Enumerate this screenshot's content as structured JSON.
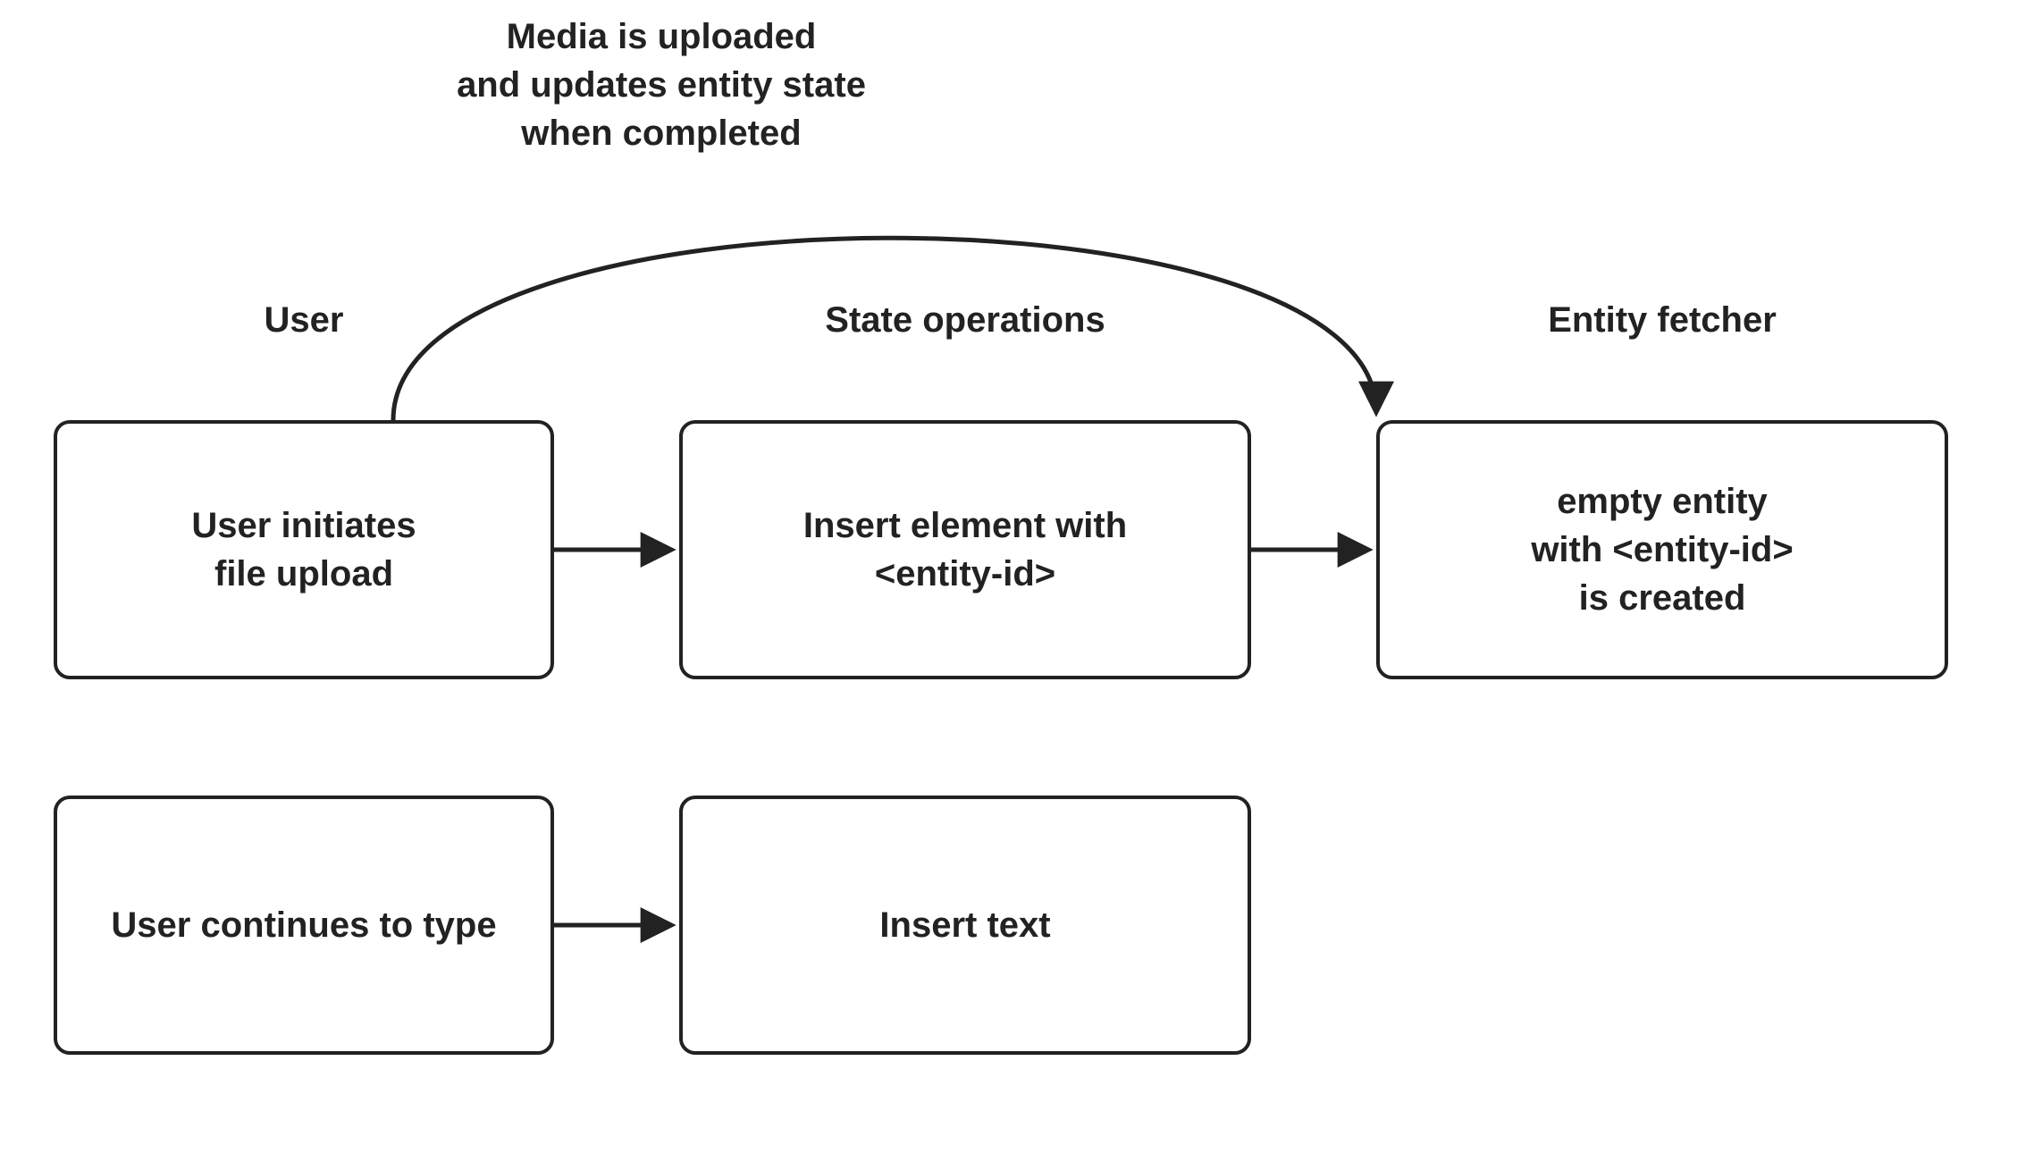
{
  "arc_label": {
    "line1": "Media is uploaded",
    "line2": "and updates entity state",
    "line3": "when completed"
  },
  "columns": {
    "user": "User",
    "state": "State operations",
    "entity": "Entity fetcher"
  },
  "boxes": {
    "user_initiate": {
      "line1": "User initiates",
      "line2": "file upload"
    },
    "insert_element": {
      "line1": "Insert element with",
      "line2": "<entity-id>"
    },
    "empty_entity": {
      "line1": "empty entity",
      "line2": "with <entity-id>",
      "line3": "is created"
    },
    "user_type": "User continues to type",
    "insert_text": "Insert text"
  }
}
